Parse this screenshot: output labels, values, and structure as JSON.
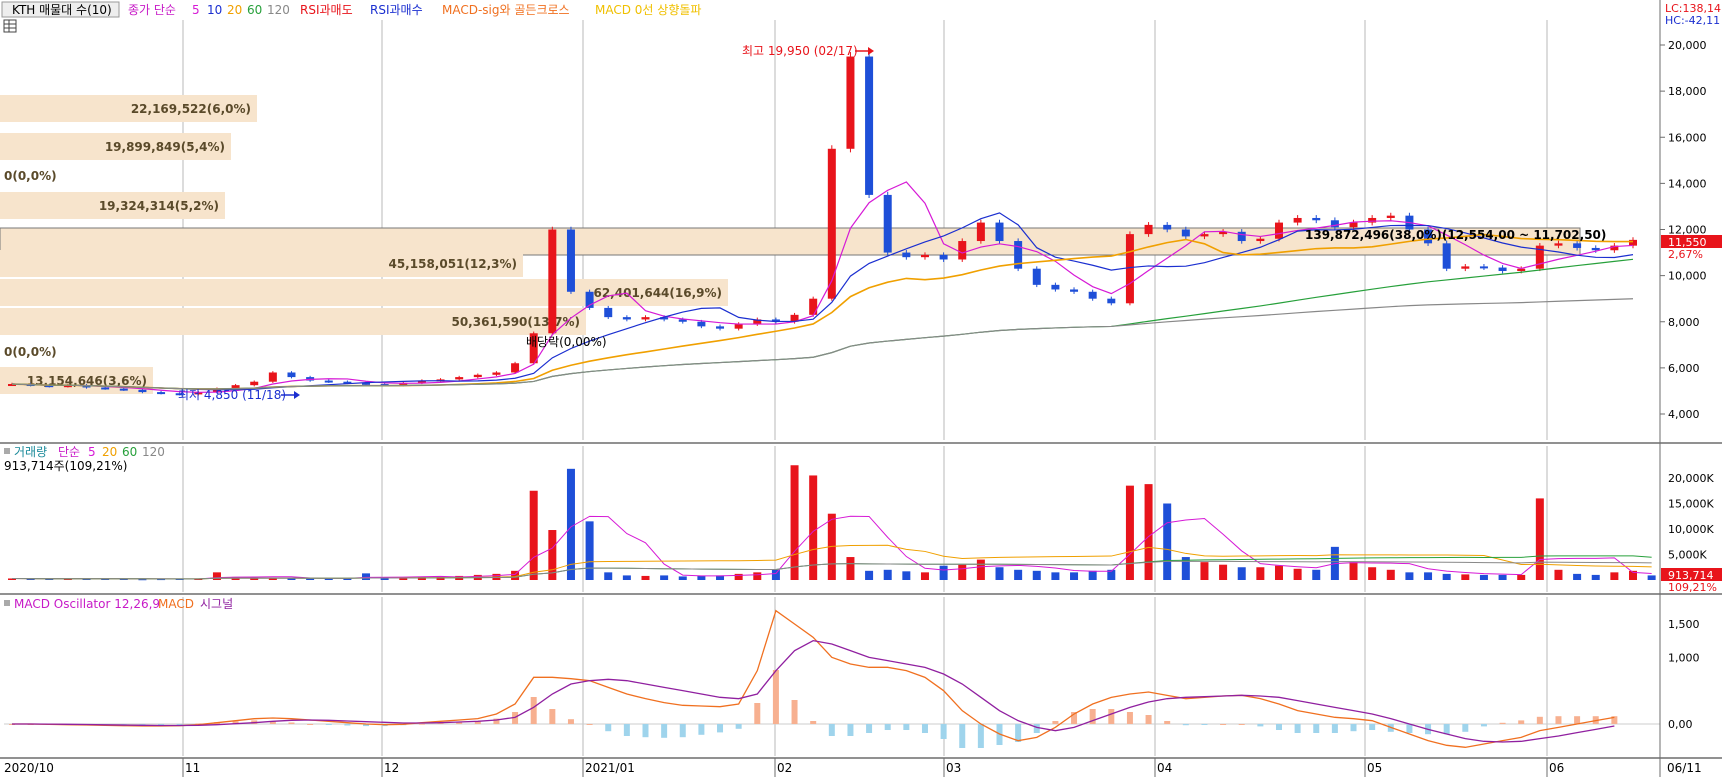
{
  "toolbar": {
    "main_chip": "KTH 매물대 수(10)",
    "ma_label": "종가 단순",
    "ma_periods": [
      "5",
      "10",
      "20",
      "60",
      "120"
    ],
    "rsi_sell": "RSI과매도",
    "rsi_buy": "RSI과매수",
    "macd_cross": "MACD-sig와 골든크로스",
    "macd_zero": "MACD 0선 상향돌파",
    "lc": "LC:138,14",
    "hc": "HC:-42,11"
  },
  "price_panel": {
    "y_ticks": [
      "20,000",
      "18,000",
      "16,000",
      "14,000",
      "12,000",
      "10,000",
      "8,000",
      "6,000",
      "4,000"
    ],
    "current_price": "11,550",
    "current_pct": "2,67%",
    "high_label": "최고 19,950 (02/17)",
    "low_label": "최저 4,850 (11/18)",
    "dividend_label": "배당락(0,00%)",
    "range_label": "139,872,496(38,0%)(12,554,00 ~ 11,702,50)",
    "volume_profile": [
      {
        "label": "22,169,522(6,0%)"
      },
      {
        "label": "19,899,849(5,4%)"
      },
      {
        "label": "0(0,0%)"
      },
      {
        "label": "19,324,314(5,2%)"
      },
      {
        "label": "139,872,496(38,0%)"
      },
      {
        "label": "45,158,051(12,3%)"
      },
      {
        "label": "62,401,644(16,9%)"
      },
      {
        "label": "50,361,590(13,7%)"
      },
      {
        "label": "0(0,0%)"
      },
      {
        "label": "13,154,646(3,6%)"
      }
    ]
  },
  "volume_panel": {
    "title": "거래량",
    "ma_label": "단순",
    "ma_periods": [
      "5",
      "20",
      "60",
      "120"
    ],
    "current_text": "913,714주(109,21%)",
    "y_ticks": [
      "20,000K",
      "15,000K",
      "10,000K",
      "5,000K"
    ],
    "current_value": "913,714",
    "current_pct": "109,21%"
  },
  "macd_panel": {
    "title": "MACD Oscillator 12,26,9",
    "macd_label": "MACD",
    "signal_label": "시그널",
    "y_ticks": [
      "1,500",
      "1,000",
      "500,00",
      "0,00"
    ]
  },
  "x_axis": {
    "labels": [
      "2020/10",
      "11",
      "12",
      "2021/01",
      "02",
      "03",
      "04",
      "05",
      "06",
      "06/11"
    ]
  },
  "colors": {
    "up": "#e8141b",
    "down": "#1e4fd8",
    "ma5": "#d61ad6",
    "ma10": "#1b2fd0",
    "ma20": "#f0a000",
    "ma60": "#27a03b",
    "ma120": "#888888",
    "macd": "#f07020",
    "signal": "#9020a0",
    "osc_pos": "#f7b090",
    "osc_neg": "#9fd4ec",
    "profile": "#f7e4cc"
  },
  "chart_data": {
    "type": "candlestick",
    "x": [
      "2020/10",
      "11",
      "12",
      "2021/01",
      "02",
      "03",
      "04",
      "05",
      "06",
      "06/11"
    ],
    "price": {
      "ylim": [
        3000,
        21000
      ],
      "high": {
        "value": 19950,
        "date": "02/17"
      },
      "low": {
        "value": 4850,
        "date": "11/18"
      },
      "last": 11550,
      "last_change_pct": 2.67,
      "points": [
        5300,
        5250,
        5200,
        5250,
        5150,
        5100,
        5050,
        4950,
        4900,
        4850,
        4950,
        5100,
        5250,
        5400,
        5800,
        5600,
        5450,
        5400,
        5350,
        5300,
        5250,
        5350,
        5450,
        5500,
        5600,
        5700,
        5800,
        6200,
        7500,
        12000,
        9300,
        8600,
        8200,
        8100,
        8200,
        8100,
        8000,
        7800,
        7700,
        7900,
        8100,
        8000,
        8300,
        9000,
        15500,
        19500,
        13500,
        11000,
        10800,
        10900,
        10700,
        11500,
        12300,
        11500,
        10300,
        9600,
        9400,
        9300,
        9000,
        8800,
        11800,
        12200,
        12000,
        11700,
        11800,
        11900,
        11500,
        11600,
        12300,
        12500,
        12400,
        12100,
        12300,
        12500,
        12600,
        12000,
        11400,
        10300,
        10400,
        10350,
        10200,
        10300,
        11300,
        11400,
        11200,
        11100,
        11300,
        11550
      ]
    },
    "volume": {
      "ylim": [
        0,
        25000
      ],
      "unit": "K",
      "last": 913.714,
      "last_pct": 109.21,
      "values": [
        300,
        250,
        200,
        220,
        250,
        300,
        200,
        150,
        180,
        200,
        300,
        1500,
        600,
        400,
        350,
        300,
        300,
        300,
        350,
        1300,
        400,
        500,
        600,
        700,
        800,
        1000,
        1200,
        1800,
        17500,
        9800,
        21800,
        11500,
        1500,
        900,
        800,
        900,
        700,
        800,
        900,
        1200,
        1500,
        2000,
        22500,
        20500,
        13000,
        4500,
        1800,
        2000,
        1700,
        1500,
        2800,
        3000,
        4000,
        2500,
        2000,
        1800,
        1500,
        1500,
        1800,
        2000,
        18500,
        18800,
        15000,
        4500,
        3500,
        3000,
        2500,
        2500,
        2800,
        2200,
        2000,
        6500,
        3500,
        2500,
        2000,
        1500,
        1500,
        1200,
        1100,
        1000,
        1000,
        1000,
        16000,
        2000,
        1200,
        1000,
        1500,
        1800,
        900
      ]
    },
    "macd": {
      "ylim": [
        -350,
        1800
      ],
      "macd": [
        0,
        0,
        -5,
        -10,
        -15,
        -20,
        -25,
        -30,
        -30,
        -25,
        -10,
        20,
        50,
        80,
        90,
        80,
        60,
        40,
        20,
        0,
        -10,
        -5,
        20,
        40,
        60,
        80,
        150,
        300,
        700,
        700,
        680,
        650,
        550,
        450,
        380,
        320,
        280,
        270,
        260,
        300,
        800,
        1700,
        1500,
        1300,
        1000,
        900,
        850,
        850,
        800,
        700,
        500,
        200,
        0,
        -150,
        -250,
        -200,
        -50,
        150,
        300,
        400,
        450,
        480,
        430,
        380,
        400,
        420,
        430,
        380,
        300,
        200,
        150,
        100,
        80,
        50,
        -50,
        -150,
        -250,
        -320,
        -350,
        -300,
        -250,
        -200,
        -100,
        -50,
        0,
        50,
        100
      ],
      "signal": [
        0,
        0,
        -2,
        -5,
        -8,
        -12,
        -16,
        -20,
        -22,
        -23,
        -20,
        -10,
        5,
        20,
        40,
        55,
        60,
        55,
        45,
        35,
        25,
        15,
        15,
        20,
        30,
        40,
        60,
        100,
        250,
        450,
        600,
        650,
        670,
        650,
        600,
        550,
        500,
        450,
        400,
        380,
        450,
        800,
        1100,
        1250,
        1200,
        1100,
        1000,
        950,
        900,
        850,
        750,
        600,
        400,
        200,
        50,
        -50,
        -100,
        -50,
        50,
        150,
        250,
        330,
        380,
        400,
        410,
        420,
        430,
        420,
        400,
        350,
        300,
        250,
        200,
        150,
        80,
        0,
        -80,
        -150,
        -220,
        -260,
        -270,
        -260,
        -220,
        -180,
        -130,
        -80,
        -30
      ]
    }
  }
}
